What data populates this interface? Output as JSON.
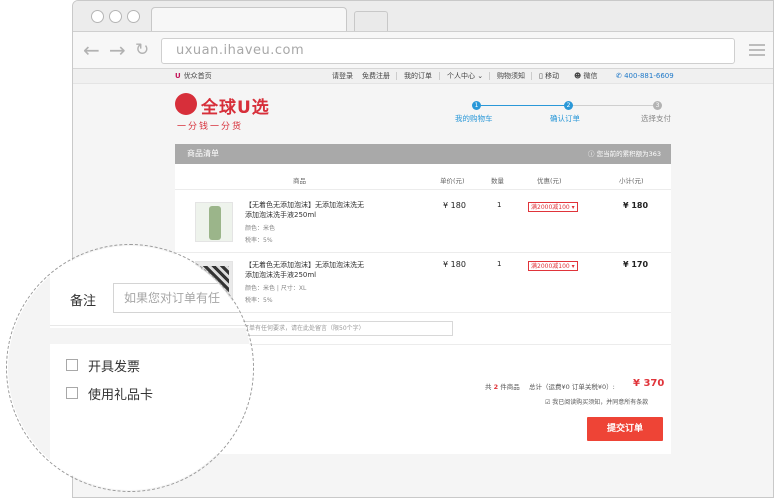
{
  "browser": {
    "url": "uxuan.ihaveu.com"
  },
  "topbar": {
    "home": "优众首页",
    "links": [
      "请登录",
      "免费注册",
      "我的订单",
      "个人中心",
      "购物须知",
      "移动",
      "微信"
    ],
    "phone": "400-881-6609"
  },
  "logo": {
    "brand": "全球U选",
    "slogan": "一分钱一分货"
  },
  "steps": [
    {
      "num": "1",
      "label": "我的购物车"
    },
    {
      "num": "2",
      "label": "确认订单"
    },
    {
      "num": "3",
      "label": "选择支付"
    }
  ],
  "panel": {
    "title": "商品清单",
    "hint": "您当前的累积额为363"
  },
  "columns": [
    "商品",
    "单价(元)",
    "数量",
    "优惠(元)",
    "小计(元)"
  ],
  "items": [
    {
      "name": "【无着色无添加泡沫】无添加泡沫洗无添加泡沫洗手液250ml",
      "spec1": "颜色：米色",
      "spec2": "税率：5%",
      "price": "¥ 180",
      "qty": "1",
      "promo": "满2000减100",
      "subtotal": "¥ 180"
    },
    {
      "name": "【无着色无添加泡沫】无添加泡沫洗无添加泡沫洗手液250ml",
      "spec1": "颜色：米色 | 尺寸：XL",
      "spec2": "税率：5%",
      "price": "¥ 180",
      "qty": "1",
      "promo": "满2000减100",
      "subtotal": "¥ 170"
    }
  ],
  "note": {
    "placeholder": "订单有任何要求，请在此处留言（限50个字）"
  },
  "summary": {
    "count_prefix": "共",
    "count": "2",
    "count_suffix": "件商品",
    "detail": "总计（运费¥0 订单关税¥0）:",
    "total": "¥ 370",
    "agree": "我已阅读购买须知，并同意所有条款",
    "submit": "提交订单"
  },
  "zoom": {
    "note_label": "备注",
    "note_placeholder": "如果您对订单有任",
    "invoice": "开具发票",
    "giftcard": "使用礼品卡"
  },
  "colors": {
    "accent_red": "#ee4436",
    "step_blue": "#2a98d8",
    "brand_red": "#d72f3a"
  }
}
